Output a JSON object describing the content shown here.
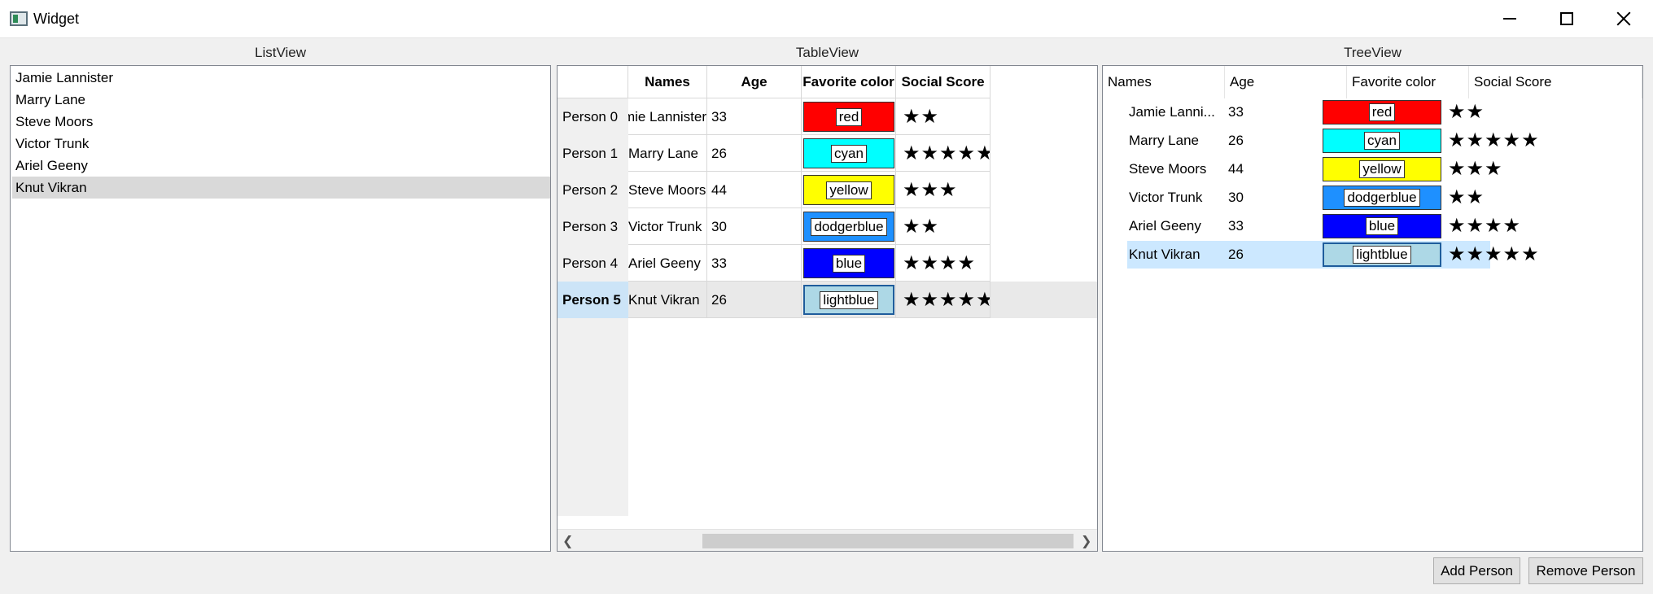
{
  "window": {
    "title": "Widget"
  },
  "panels": {
    "list_label": "ListView",
    "table_label": "TableView",
    "tree_label": "TreeView"
  },
  "list": {
    "items": [
      "Jamie Lannister",
      "Marry Lane",
      "Steve Moors",
      "Victor Trunk",
      "Ariel Geeny",
      "Knut Vikran"
    ],
    "selected_index": 5
  },
  "table": {
    "headers": [
      "Names",
      "Age",
      "Favorite color",
      "Social Score"
    ],
    "row_headers": [
      "Person 0",
      "Person 1",
      "Person 2",
      "Person 3",
      "Person 4",
      "Person 5"
    ],
    "rows": [
      {
        "name": "Jamie Lannister",
        "age": "33",
        "color": "red",
        "score": "★★"
      },
      {
        "name": "Marry Lane",
        "age": "26",
        "color": "cyan",
        "score": "★★★★★"
      },
      {
        "name": "Steve Moors",
        "age": "44",
        "color": "yellow",
        "score": "★★★"
      },
      {
        "name": "Victor Trunk",
        "age": "30",
        "color": "dodgerblue",
        "score": "★★"
      },
      {
        "name": "Ariel Geeny",
        "age": "33",
        "color": "blue",
        "score": "★★★★"
      },
      {
        "name": "Knut Vikran",
        "age": "26",
        "color": "lightblue",
        "score": "★★★★★"
      }
    ],
    "selected_index": 5
  },
  "tree": {
    "headers": [
      "Names",
      "Age",
      "Favorite color",
      "Social Score"
    ],
    "rows": [
      {
        "name": "Jamie Lanni...",
        "age": "33",
        "color": "red",
        "score": "★★"
      },
      {
        "name": "Marry Lane",
        "age": "26",
        "color": "cyan",
        "score": "★★★★★"
      },
      {
        "name": "Steve Moors",
        "age": "44",
        "color": "yellow",
        "score": "★★★"
      },
      {
        "name": "Victor Trunk",
        "age": "30",
        "color": "dodgerblue",
        "score": "★★"
      },
      {
        "name": "Ariel Geeny",
        "age": "33",
        "color": "blue",
        "score": "★★★★"
      },
      {
        "name": "Knut Vikran",
        "age": "26",
        "color": "lightblue",
        "score": "★★★★★"
      }
    ],
    "selected_index": 5
  },
  "buttons": {
    "add": "Add Person",
    "remove": "Remove Person"
  },
  "colors": {
    "red": "#ff0000",
    "cyan": "#00ffff",
    "yellow": "#ffff00",
    "dodgerblue": "#1e90ff",
    "blue": "#0000ff",
    "lightblue": "#add8e6",
    "selection": "#cce8ff"
  },
  "icons": {
    "minimize": "minimize-icon",
    "maximize": "maximize-icon",
    "close": "close-icon"
  }
}
